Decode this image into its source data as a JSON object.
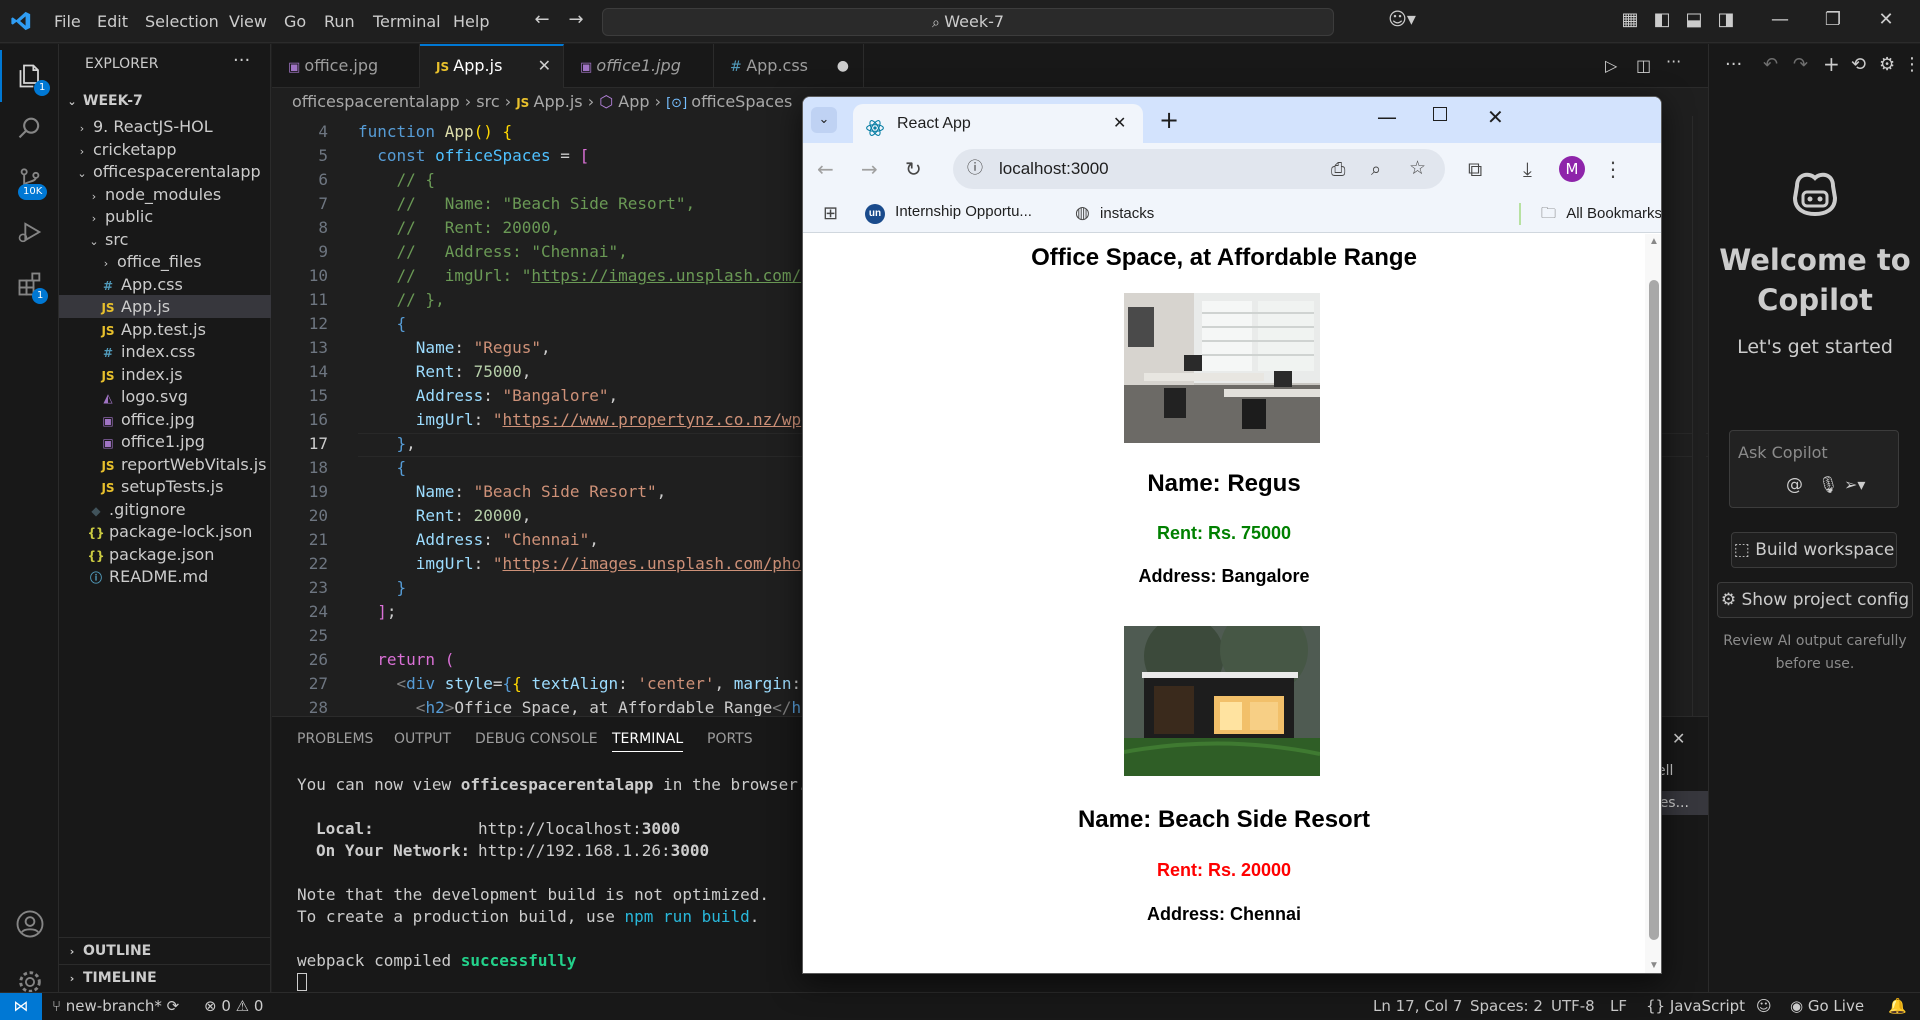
{
  "titlebar": {
    "menu": [
      "File",
      "Edit",
      "Selection",
      "View",
      "Go",
      "Run",
      "Terminal",
      "Help"
    ],
    "search_text": "Week-7"
  },
  "activity": {
    "source_control_badge": "10K",
    "explorer_badge": "1",
    "extensions_badge": "1"
  },
  "explorer": {
    "title": "EXPLORER",
    "root": "WEEK-7",
    "items": [
      {
        "label": "9. ReactJS-HOL",
        "type": "folder",
        "depth": 1,
        "open": false
      },
      {
        "label": "cricketapp",
        "type": "folder",
        "depth": 1,
        "open": false
      },
      {
        "label": "officespacerentalapp",
        "type": "folder",
        "depth": 1,
        "open": true
      },
      {
        "label": "node_modules",
        "type": "folder",
        "depth": 2,
        "open": false
      },
      {
        "label": "public",
        "type": "folder",
        "depth": 2,
        "open": false
      },
      {
        "label": "src",
        "type": "folder",
        "depth": 2,
        "open": true
      },
      {
        "label": "office_files",
        "type": "folder",
        "depth": 3,
        "open": false
      },
      {
        "label": "App.css",
        "type": "css",
        "depth": 3
      },
      {
        "label": "App.js",
        "type": "js",
        "depth": 3,
        "selected": true
      },
      {
        "label": "App.test.js",
        "type": "js",
        "depth": 3
      },
      {
        "label": "index.css",
        "type": "css",
        "depth": 3
      },
      {
        "label": "index.js",
        "type": "js",
        "depth": 3
      },
      {
        "label": "logo.svg",
        "type": "svg",
        "depth": 3
      },
      {
        "label": "office.jpg",
        "type": "img",
        "depth": 3
      },
      {
        "label": "office1.jpg",
        "type": "img",
        "depth": 3
      },
      {
        "label": "reportWebVitals.js",
        "type": "js",
        "depth": 3
      },
      {
        "label": "setupTests.js",
        "type": "js",
        "depth": 3
      },
      {
        "label": ".gitignore",
        "type": "git",
        "depth": 2
      },
      {
        "label": "package-lock.json",
        "type": "json",
        "depth": 2
      },
      {
        "label": "package.json",
        "type": "json",
        "depth": 2
      },
      {
        "label": "README.md",
        "type": "info",
        "depth": 2
      }
    ],
    "outline": "OUTLINE",
    "timeline": "TIMELINE"
  },
  "tabs": [
    {
      "label": "office.jpg",
      "icon": "image-icon"
    },
    {
      "label": "App.js",
      "icon": "js-icon",
      "active": true
    },
    {
      "label": "office1.jpg",
      "icon": "image-icon"
    },
    {
      "label": "App.css",
      "icon": "css-icon",
      "modified": true
    }
  ],
  "breadcrumb": [
    "officespacerentalapp",
    "src",
    "App.js",
    "App",
    "officeSpaces"
  ],
  "code": {
    "line_numbers": [
      "4",
      "5",
      "6",
      "7",
      "8",
      "9",
      "10",
      "11",
      "12",
      "13",
      "14",
      "15",
      "16",
      "17",
      "18",
      "19",
      "20",
      "21",
      "22",
      "23",
      "24",
      "25",
      "26",
      "27",
      "28"
    ],
    "current_line": "17"
  },
  "panel": {
    "tabs": [
      "PROBLEMS",
      "OUTPUT",
      "DEBUG CONSOLE",
      "TERMINAL",
      "PORTS"
    ],
    "active_tab": "TERMINAL",
    "t1a": "You can now view ",
    "t1b": "officespacerentalapp",
    "t1c": " in the browser.",
    "local_label": "Local:",
    "local_url_a": "http://localhost:",
    "local_url_b": "3000",
    "net_label": "On Your Network:",
    "net_url_a": "http://192.168.1.26:",
    "net_url_b": "3000",
    "note1": "Note that the development build is not optimized.",
    "note2a": "To create a production build, use ",
    "note2b": "npm run build",
    "note2c": ".",
    "compiled_a": "webpack compiled ",
    "compiled_b": "successfully",
    "side_a": "ell",
    "side_b": "ces..."
  },
  "copilot": {
    "title": "Welcome to Copilot",
    "subtitle": "Let's get started",
    "ask_placeholder": "Ask Copilot",
    "build_workspace": "Build workspace",
    "show_config": "Show project config",
    "disclaimer": "Review AI output carefully before use."
  },
  "statusbar": {
    "branch": "new-branch*",
    "errors": "0",
    "warnings": "0",
    "position": "Ln 17, Col 7",
    "spaces": "Spaces: 2",
    "encoding": "UTF-8",
    "eol": "LF",
    "language": "JavaScript",
    "golive": "Go Live"
  },
  "browser": {
    "tab_title": "React App",
    "url": "localhost:3000",
    "bookmarks": [
      "Internship Opportu...",
      "instacks"
    ],
    "all_bookmarks": "All Bookmarks",
    "profile_initial": "M",
    "page": {
      "heading": "Office Space, at Affordable Range",
      "offices": [
        {
          "name": "Name: Regus",
          "rent": "Rent: Rs. 75000",
          "address": "Address: Bangalore",
          "rent_color": "#008000"
        },
        {
          "name": "Name: Beach Side Resort",
          "rent": "Rent: Rs. 20000",
          "address": "Address: Chennai",
          "rent_color": "#ff0000"
        }
      ]
    }
  }
}
